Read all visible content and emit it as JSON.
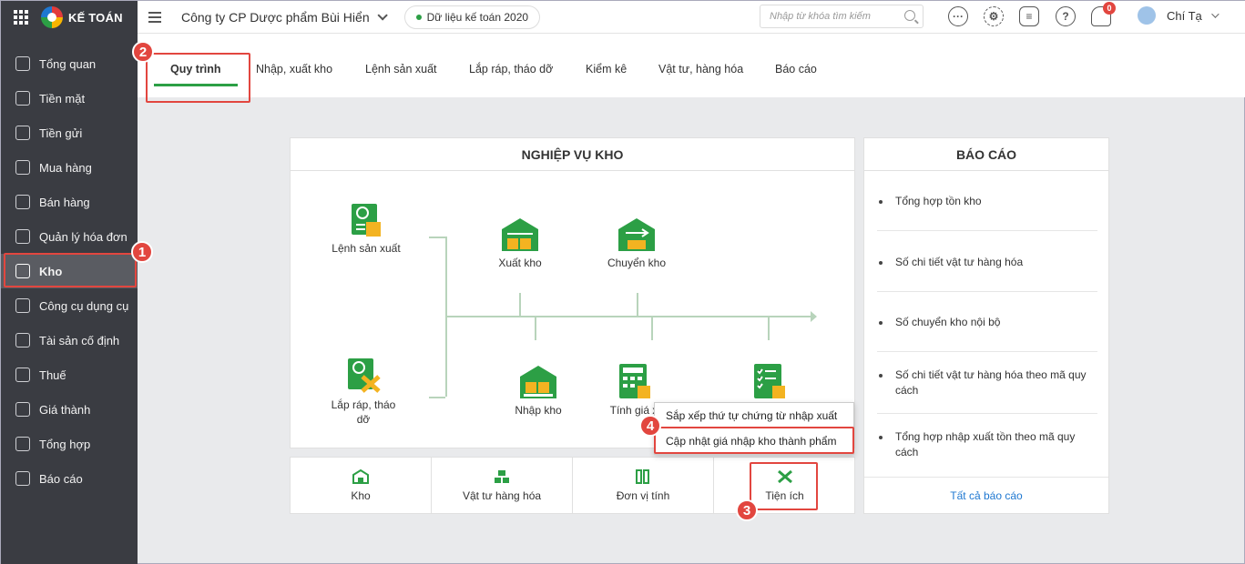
{
  "app": {
    "logo_text": "KẾ TOÁN"
  },
  "topbar": {
    "company": "Công ty CP Dược phẩm Bùi Hiển",
    "data_label": "Dữ liệu kế toán 2020",
    "search_placeholder": "Nhập từ khóa tìm kiếm",
    "notification_count": "0",
    "user_name": "Chí Tạ",
    "icons": [
      "chat-bubble-dots-icon",
      "gear-icon",
      "message-icon",
      "help-icon",
      "bell-icon"
    ]
  },
  "sidebar": {
    "items": [
      {
        "label": "Tổng quan",
        "icon": "overview-icon"
      },
      {
        "label": "Tiền mặt",
        "icon": "cash-icon"
      },
      {
        "label": "Tiền gửi",
        "icon": "bank-icon"
      },
      {
        "label": "Mua hàng",
        "icon": "shopping-bag-icon"
      },
      {
        "label": "Bán hàng",
        "icon": "cart-icon"
      },
      {
        "label": "Quản lý hóa đơn",
        "icon": "invoice-icon"
      },
      {
        "label": "Kho",
        "icon": "warehouse-icon",
        "active": true
      },
      {
        "label": "Công cụ dụng cụ",
        "icon": "tools-icon"
      },
      {
        "label": "Tài sản cố định",
        "icon": "car-icon"
      },
      {
        "label": "Thuế",
        "icon": "tax-icon"
      },
      {
        "label": "Giá thành",
        "icon": "price-tag-icon"
      },
      {
        "label": "Tổng hợp",
        "icon": "summary-icon"
      },
      {
        "label": "Báo cáo",
        "icon": "report-chart-icon"
      }
    ]
  },
  "tabs": [
    "Quy trình",
    "Nhập, xuất kho",
    "Lệnh sản xuất",
    "Lắp ráp, tháo dỡ",
    "Kiểm kê",
    "Vật tư, hàng hóa",
    "Báo cáo"
  ],
  "process": {
    "title": "NGHIỆP VỤ KHO",
    "nodes": {
      "production_order": "Lệnh sản xuất",
      "assembly": "Lắp ráp, tháo dỡ",
      "export": "Xuất kho",
      "transfer": "Chuyển kho",
      "import": "Nhập kho",
      "price_calc": "Tính giá x"
    },
    "bottom": [
      "Kho",
      "Vật tư hàng hóa",
      "Đơn vị tính",
      "Tiện ích"
    ]
  },
  "dropdown": {
    "items": [
      "Sắp xếp thứ tự chứng từ nhập xuất",
      "Cập nhật giá nhập kho thành phẩm"
    ]
  },
  "reports": {
    "title": "BÁO CÁO",
    "items": [
      "Tổng hợp tồn kho",
      "Số chi tiết vật tư hàng hóa",
      "Số chuyển kho nội bộ",
      "Số chi tiết vật tư hàng hóa theo mã quy cách",
      "Tổng hợp nhập xuất tồn theo mã quy cách"
    ],
    "all_link": "Tất cả báo cáo"
  },
  "annotations": [
    "1",
    "2",
    "3",
    "4"
  ],
  "colors": {
    "accent_green": "#2c9f45",
    "highlight_red": "#e2463f",
    "sidebar_bg": "#3a3c42"
  }
}
